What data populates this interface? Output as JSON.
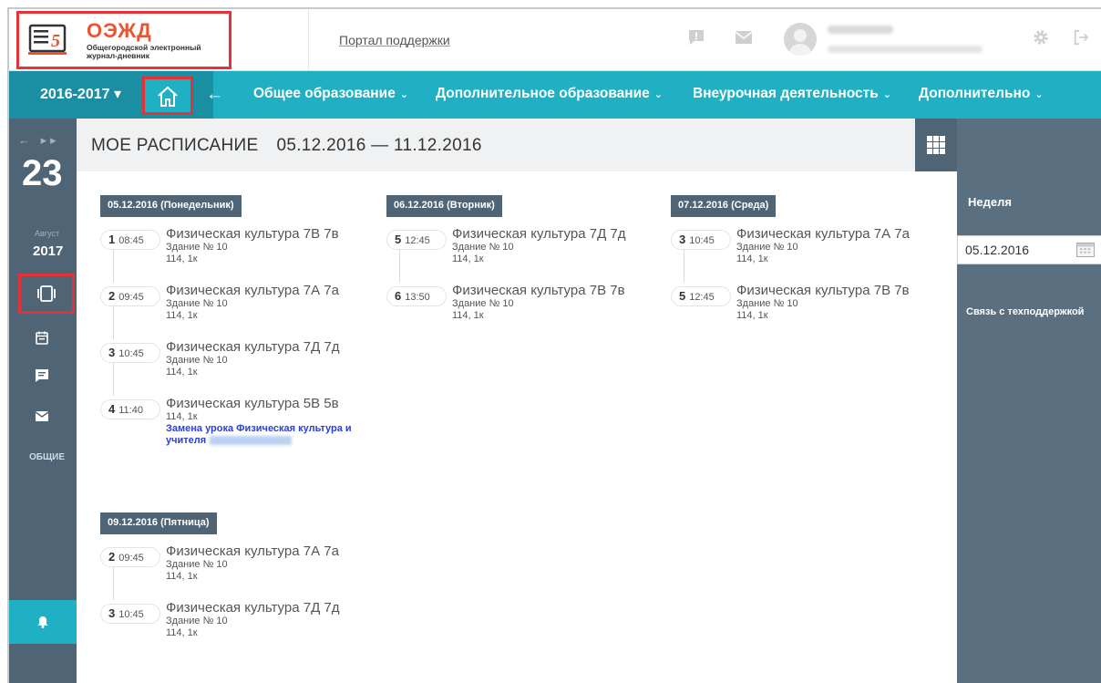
{
  "header": {
    "logo_title": "ОЭЖД",
    "logo_subtitle": "Общегородской электронный журнал-дневник",
    "support_link": "Портал поддержки"
  },
  "nav": {
    "year": "2016-2017 ▾",
    "back": "←",
    "items": [
      {
        "label": "Общее образование"
      },
      {
        "label": "Дополнительное образование"
      },
      {
        "label": "Внеурочная деятельность"
      },
      {
        "label": "Дополнительно"
      }
    ],
    "chevron": "⌄"
  },
  "sidebar": {
    "arrows": "← ▸▸",
    "day": "23",
    "month": "Август",
    "year": "2017",
    "common": "ОБЩИЕ"
  },
  "page": {
    "title": "МОЕ РАСПИСАНИЕ",
    "range": "05.12.2016 — 11.12.2016"
  },
  "schedule": {
    "monday": {
      "label": "05.12.2016 (Понедельник)",
      "lessons": [
        {
          "num": "1",
          "time": "08:45",
          "subject": "Физическая культура 7В 7в",
          "building": "Здание № 10",
          "room": "114, 1к"
        },
        {
          "num": "2",
          "time": "09:45",
          "subject": "Физическая культура 7А 7а",
          "building": "Здание № 10",
          "room": "114, 1к"
        },
        {
          "num": "3",
          "time": "10:45",
          "subject": "Физическая культура 7Д 7д",
          "building": "Здание № 10",
          "room": "114, 1к"
        },
        {
          "num": "4",
          "time": "11:40",
          "subject": "Физическая культура 5В 5в",
          "room": "114, 1к",
          "replacement": "Замена урока Физическая культура и учителя"
        }
      ]
    },
    "tuesday": {
      "label": "06.12.2016 (Вторник)",
      "lessons": [
        {
          "num": "5",
          "time": "12:45",
          "subject": "Физическая культура 7Д 7д",
          "building": "Здание № 10",
          "room": "114, 1к"
        },
        {
          "num": "6",
          "time": "13:50",
          "subject": "Физическая культура 7В 7в",
          "building": "Здание № 10",
          "room": "114, 1к"
        }
      ]
    },
    "wednesday": {
      "label": "07.12.2016 (Среда)",
      "lessons": [
        {
          "num": "3",
          "time": "10:45",
          "subject": "Физическая культура 7А 7а",
          "building": "Здание № 10",
          "room": "114, 1к"
        },
        {
          "num": "5",
          "time": "12:45",
          "subject": "Физическая культура 7В 7в",
          "building": "Здание № 10",
          "room": "114, 1к"
        }
      ]
    },
    "friday": {
      "label": "09.12.2016 (Пятница)",
      "lessons": [
        {
          "num": "2",
          "time": "09:45",
          "subject": "Физическая культура 7А 7а",
          "building": "Здание № 10",
          "room": "114, 1к"
        },
        {
          "num": "3",
          "time": "10:45",
          "subject": "Физическая культура 7Д 7д",
          "building": "Здание № 10",
          "room": "114, 1к"
        }
      ]
    }
  },
  "right_panel": {
    "week_label": "Неделя",
    "date_value": "05.12.2016",
    "support": "Связь с техподдержкой"
  },
  "colors": {
    "accent": "#1fb0c4",
    "dark_panel": "#4f6474",
    "highlight": "#e53238",
    "logo": "#e8552f"
  }
}
